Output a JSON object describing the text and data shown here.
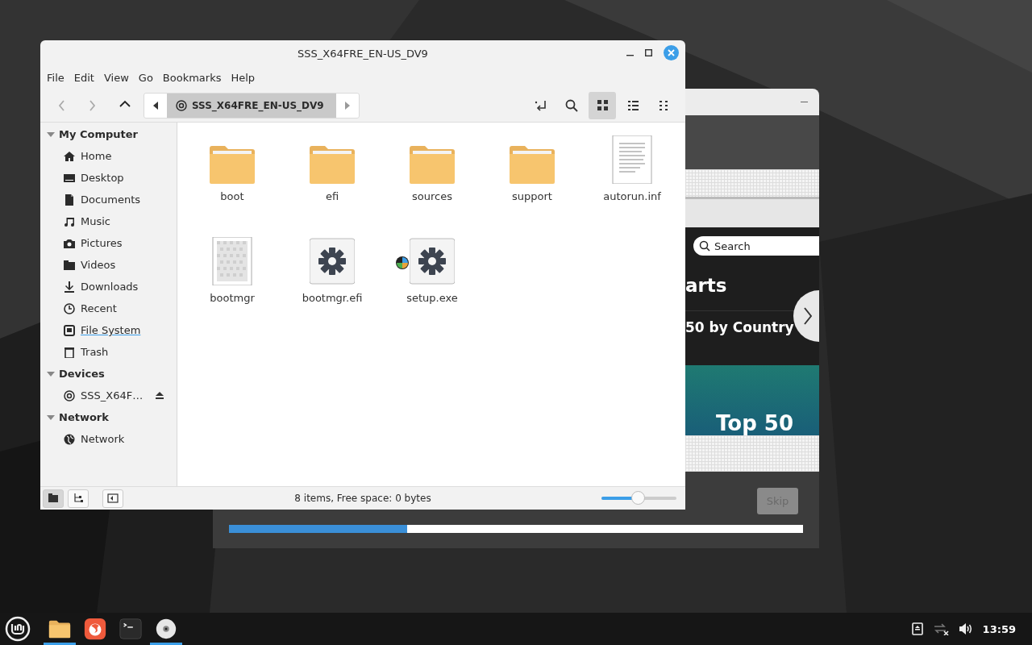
{
  "file_manager": {
    "title": "SSS_X64FRE_EN-US_DV9",
    "menu": [
      "File",
      "Edit",
      "View",
      "Go",
      "Bookmarks",
      "Help"
    ],
    "nav": [
      {
        "kind": "back",
        "disabled": true
      },
      {
        "kind": "forward",
        "disabled": true
      },
      {
        "kind": "up",
        "disabled": false
      }
    ],
    "path": "SSS_X64FRE_EN-US_DV9",
    "view_buttons": [
      {
        "kind": "icons",
        "selected": true
      },
      {
        "kind": "list",
        "selected": false
      },
      {
        "kind": "compact",
        "selected": false
      }
    ],
    "sidebar": [
      {
        "title": "My Computer",
        "expanded": true,
        "items": [
          {
            "label": "Home",
            "kind": "home",
            "hovered": false
          },
          {
            "label": "Desktop",
            "kind": "desktop",
            "hovered": false
          },
          {
            "label": "Documents",
            "kind": "documents",
            "hovered": false
          },
          {
            "label": "Music",
            "kind": "music",
            "hovered": false
          },
          {
            "label": "Pictures",
            "kind": "pictures",
            "hovered": false
          },
          {
            "label": "Videos",
            "kind": "videos",
            "hovered": false
          },
          {
            "label": "Downloads",
            "kind": "downloads",
            "hovered": false
          },
          {
            "label": "Recent",
            "kind": "recent",
            "hovered": false
          },
          {
            "label": "File System",
            "kind": "filesystem",
            "hovered": true
          },
          {
            "label": "Trash",
            "kind": "trash",
            "hovered": false
          }
        ]
      },
      {
        "title": "Devices",
        "expanded": true,
        "items": [
          {
            "label": "SSS_X64F…",
            "kind": "disc",
            "hovered": false,
            "ejectable": true
          }
        ]
      },
      {
        "title": "Network",
        "expanded": true,
        "items": [
          {
            "label": "Network",
            "kind": "network",
            "hovered": false
          }
        ]
      }
    ],
    "files": [
      {
        "name": "boot",
        "kind": "folder"
      },
      {
        "name": "efi",
        "kind": "folder"
      },
      {
        "name": "sources",
        "kind": "folder"
      },
      {
        "name": "support",
        "kind": "folder"
      },
      {
        "name": "autorun.inf",
        "kind": "text"
      },
      {
        "name": "bootmgr"
      },
      {
        "name": "bootmgr.efi",
        "kind": "executable"
      },
      {
        "name": "setup.exe",
        "kind": "executable"
      }
    ],
    "bottom_buttons": [
      {
        "kind": "places",
        "selected": true
      },
      {
        "kind": "tree",
        "selected": false
      },
      {
        "kind": "sidebar",
        "selected": false
      }
    ],
    "status": "8 items, Free space: 0 bytes",
    "zoom": {
      "level": 0.49
    }
  },
  "background_window": {
    "search": {
      "placeholder": "Search"
    },
    "heading": "arts",
    "subheading": "50 by Country",
    "banner": "Top 50",
    "skip": {
      "label": "Skip",
      "disabled": true
    },
    "progress": {
      "level": 0.31
    }
  },
  "taskbar": {
    "apps": [
      {
        "kind": "folder",
        "running": true
      },
      {
        "kind": "browser",
        "running": false
      },
      {
        "kind": "terminal",
        "running": false
      },
      {
        "kind": "disc",
        "running": true
      }
    ],
    "clock": "13:59"
  }
}
